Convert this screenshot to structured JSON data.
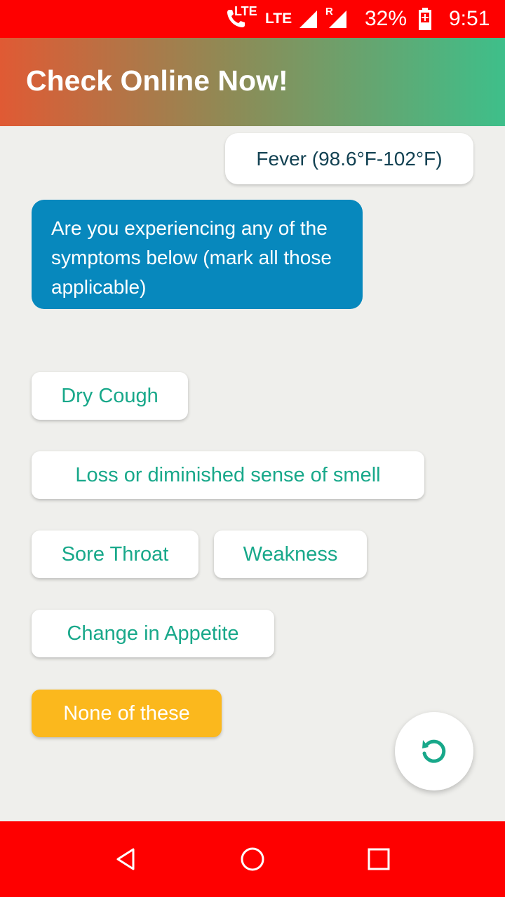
{
  "status_bar": {
    "lte_call_label": "LTE",
    "lte_label": "LTE",
    "roaming_label": "R",
    "battery_percent": "32%",
    "time": "9:51"
  },
  "app_bar": {
    "title": "Check Online Now!"
  },
  "chat": {
    "user_message": "Fever (98.6°F-102°F)",
    "bot_message": "Are you experiencing any of the symptoms below (mark all those applicable)"
  },
  "options": [
    "Dry Cough",
    "Loss or diminished sense of smell",
    "Sore Throat",
    "Weakness",
    "Change in Appetite",
    "None of these"
  ],
  "colors": {
    "status_bar": "#fe0000",
    "option_text": "#18a88a",
    "bot_bubble": "#0788bd",
    "none_option": "#fbb81d"
  },
  "icons": {
    "refresh": "refresh-icon",
    "back": "back-icon",
    "home": "home-icon",
    "recents": "recents-icon"
  }
}
